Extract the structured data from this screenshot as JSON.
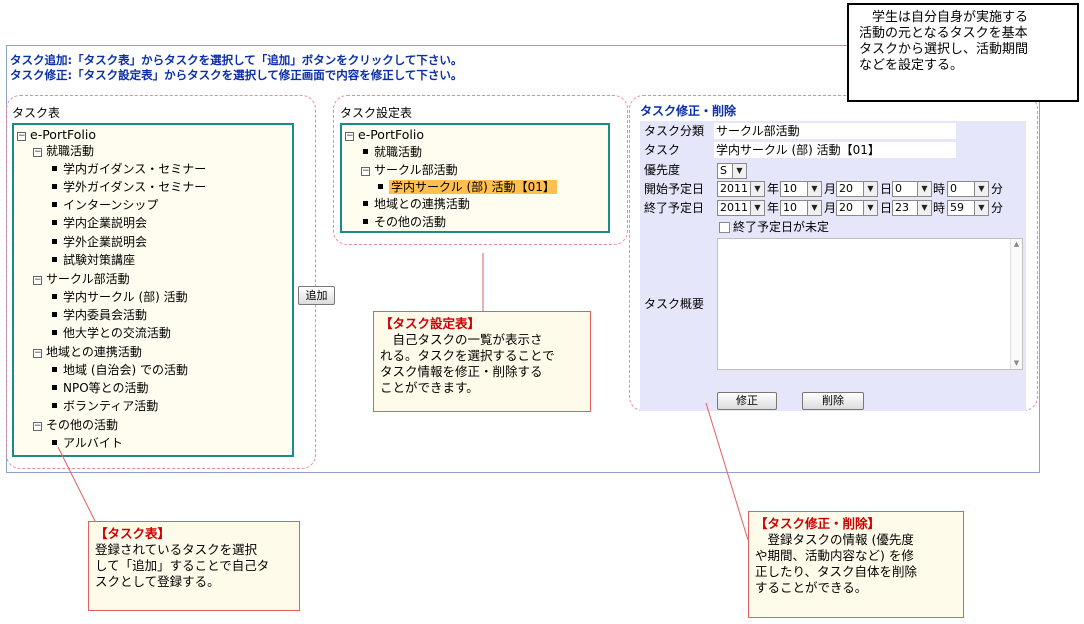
{
  "note": {
    "lines": [
      "　学生は自分自身が実施する",
      "活動の元となるタスクを基本",
      "タスクから選択し、活動期間",
      "などを設定する。"
    ]
  },
  "instructions": {
    "line1": "タスク追加:「タスク表」からタスクを選択して「追加」ボタンをクリックして下さい。",
    "line2": "タスク修正:「タスク設定表」からタスクを選択して修正画面で内容を修正して下さい。"
  },
  "task_table": {
    "title": "タスク表",
    "root": "e-PortFolio",
    "nodes": [
      {
        "label": "就職活動"
      },
      {
        "label": "学内ガイダンス・セミナー"
      },
      {
        "label": "学外ガイダンス・セミナー"
      },
      {
        "label": "インターンシップ"
      },
      {
        "label": "学内企業説明会"
      },
      {
        "label": "学外企業説明会"
      },
      {
        "label": "試験対策講座"
      },
      {
        "label": "サークル部活動"
      },
      {
        "label": "学内サークル (部) 活動"
      },
      {
        "label": "学内委員会活動"
      },
      {
        "label": "他大学との交流活動"
      },
      {
        "label": "地域との連携活動"
      },
      {
        "label": "地域 (自治会) での活動"
      },
      {
        "label": "NPO等との活動"
      },
      {
        "label": "ボランティア活動"
      },
      {
        "label": "その他の活動"
      },
      {
        "label": "アルバイト"
      }
    ]
  },
  "add_button": "追加",
  "task_settings": {
    "title": "タスク設定表",
    "root": "e-PortFolio",
    "nodes": [
      {
        "label": "就職活動"
      },
      {
        "label": "サークル部活動"
      },
      {
        "label": "学内サークル (部) 活動【01】"
      },
      {
        "label": "地域との連携活動"
      },
      {
        "label": "その他の活動"
      }
    ]
  },
  "edit": {
    "title": "タスク修正・削除",
    "category_label": "タスク分類",
    "category_value": "サークル部活動",
    "task_label": "タスク",
    "task_value": "学内サークル (部) 活動【01】",
    "priority_label": "優先度",
    "priority_value": "S",
    "start_label": "開始予定日",
    "start": {
      "year": "2011",
      "month": "10",
      "day": "20",
      "hour": "0",
      "minute": "0"
    },
    "end_label": "終了予定日",
    "end": {
      "year": "2011",
      "month": "10",
      "day": "20",
      "hour": "23",
      "minute": "59"
    },
    "units": {
      "year": "年",
      "month": "月",
      "day": "日",
      "hour": "時",
      "minute": "分"
    },
    "undecided_label": "終了予定日が未定",
    "undecided_checked": false,
    "summary_label": "タスク概要",
    "summary_value": "",
    "modify_button": "修正",
    "delete_button": "削除"
  },
  "callouts": {
    "settings": {
      "title": "【タスク設定表】",
      "lines": [
        "　自己タスクの一覧が表示さ",
        "れる。タスクを選択することで",
        "タスク情報を修正・削除する",
        "ことができます。"
      ]
    },
    "table": {
      "title": "【タスク表】",
      "lines": [
        "登録されているタスクを選択",
        "して「追加」することで自己タ",
        "スクとして登録する。"
      ]
    },
    "edit": {
      "title": "【タスク修正・削除】",
      "lines": [
        "　登録タスクの情報 (優先度",
        "や期間、活動内容など) を修",
        "正したり、タスク自体を削除",
        "することができる。"
      ]
    }
  },
  "colors": {
    "accent_blue": "#0a2fa8",
    "tree_border": "#1a8a8a",
    "selection": "#ffc04d",
    "callout_title": "#cc0000",
    "edit_bg": "#e6e6fa"
  }
}
